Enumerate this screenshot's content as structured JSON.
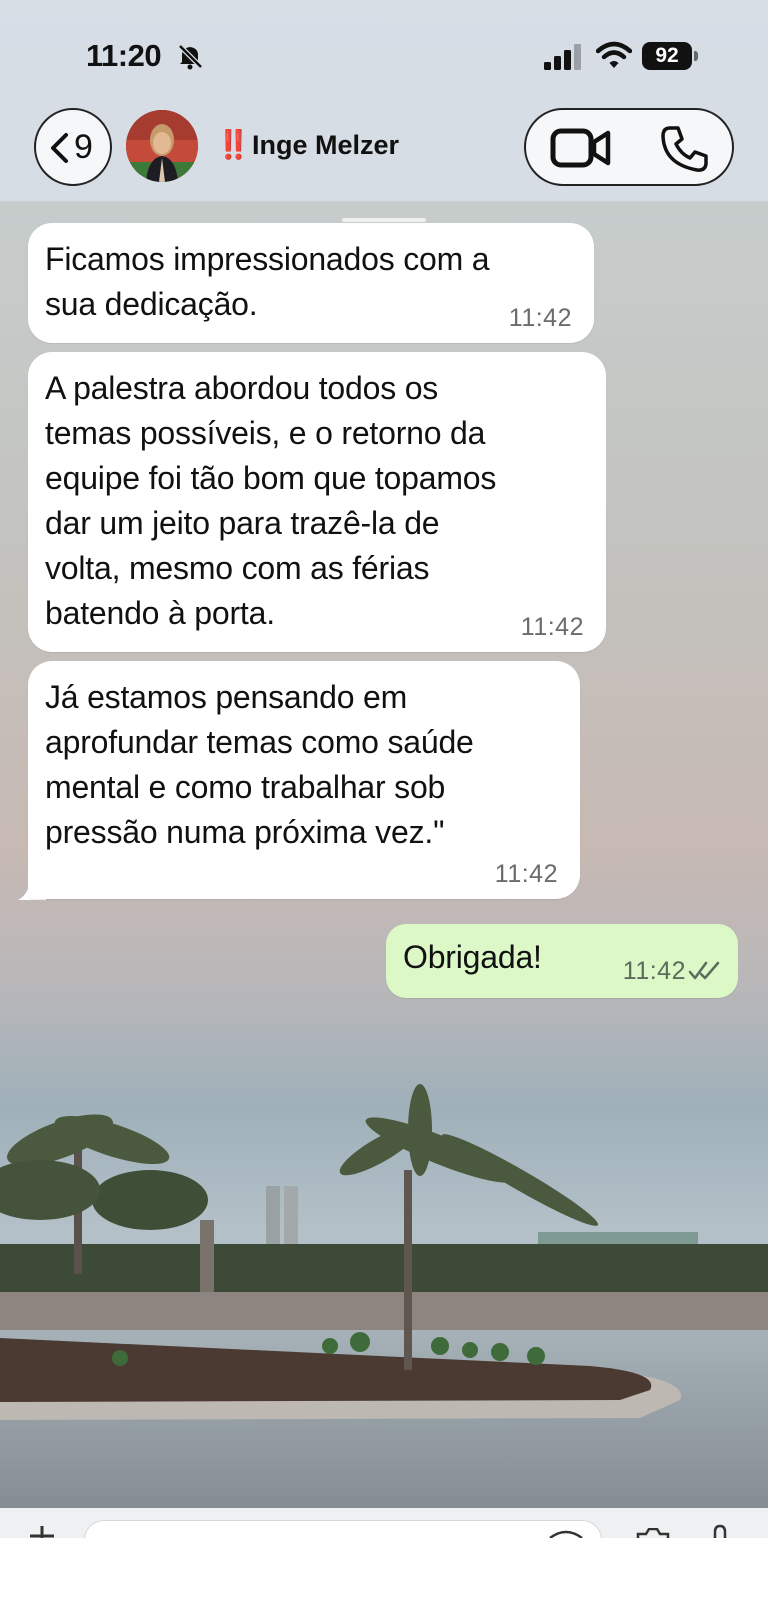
{
  "status_bar": {
    "time": "11:20",
    "battery_level": "92",
    "icons": [
      "bell-slash-icon",
      "signal-icon",
      "wifi-icon",
      "battery-icon"
    ]
  },
  "header": {
    "back_count": "9",
    "contact_alert": "‼️",
    "contact_name": "Inge Melzer",
    "icons": [
      "back-chevron-icon",
      "avatar",
      "video-call-icon",
      "phone-call-icon"
    ]
  },
  "messages": [
    {
      "direction": "incoming",
      "lines": [
        "Ficamos impressionados com a",
        "sua dedicação."
      ],
      "time": "11:42"
    },
    {
      "direction": "incoming",
      "lines": [
        "A palestra abordou todos os",
        "temas possíveis, e o retorno da",
        "equipe foi tão bom que topamos",
        "dar um jeito para trazê-la de",
        "volta, mesmo com as férias",
        "batendo à porta."
      ],
      "time": "11:42"
    },
    {
      "direction": "incoming",
      "lines": [
        "Já estamos pensando em",
        "aprofundar temas como saúde",
        "mental e como trabalhar sob",
        "pressão numa próxima vez.\""
      ],
      "time": "11:42"
    },
    {
      "direction": "outgoing",
      "lines": [
        "Obrigada!"
      ],
      "time": "11:42",
      "status": "read"
    }
  ],
  "colors": {
    "outgoing_bubble": "#dcf8c6",
    "incoming_bubble": "#ffffff",
    "alert": "#e0201a",
    "header_bg": "#d6dee6"
  },
  "composer": {
    "icons": [
      "plus-icon",
      "sticker-icon",
      "camera-icon",
      "mic-icon"
    ]
  }
}
